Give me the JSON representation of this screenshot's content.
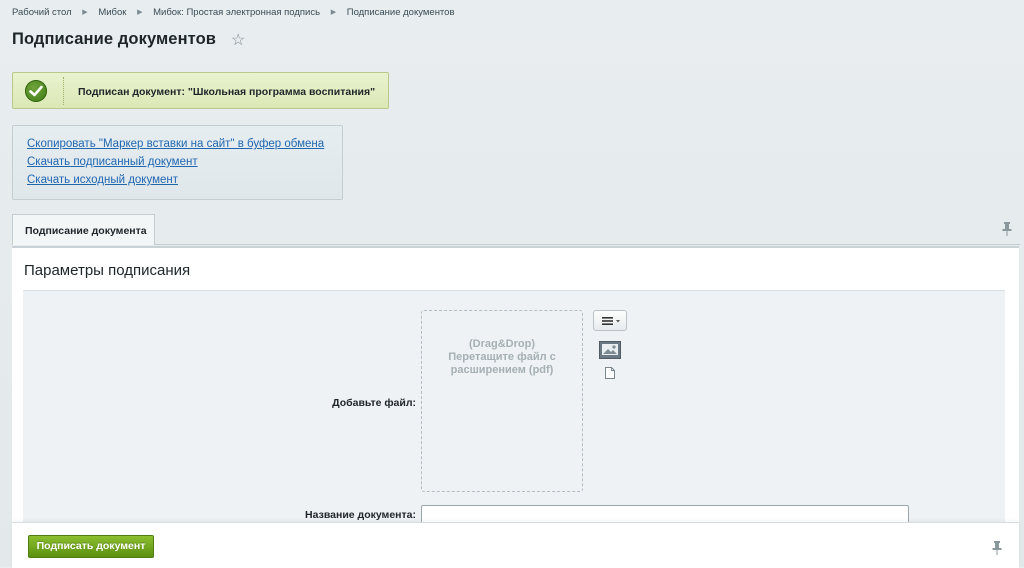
{
  "breadcrumb": {
    "items": [
      "Рабочий стол",
      "Мибок",
      "Мибок: Простая электронная подпись",
      "Подписание документов"
    ]
  },
  "page": {
    "title": "Подписание документов"
  },
  "notice": {
    "text": "Подписан документ:  \"Школьная программа воспитания\""
  },
  "links": {
    "copy_marker": "Скопировать \"Маркер вставки на сайт\" в буфер обмена",
    "download_signed": "Скачать подписанный документ",
    "download_original": "Скачать исходный документ"
  },
  "tabs": [
    {
      "label": "Подписание документа"
    }
  ],
  "form": {
    "section_title": "Параметры подписания",
    "file_label": "Добавьте файл:",
    "dropzone_line1": "(Drag&Drop)",
    "dropzone_line2": "Перетащите файл с",
    "dropzone_line3": "расширением (pdf)",
    "doc_name_label": "Название документа:",
    "doc_name_value": ""
  },
  "footer": {
    "submit_label": "Подписать документ"
  },
  "colors": {
    "accent_green": "#6aa01c",
    "link_blue": "#2067b0",
    "notice_bg": "#e2edc3"
  },
  "icons": [
    "star-icon",
    "checkmark-icon",
    "pin-icon",
    "menu-icon",
    "image-icon",
    "file-icon"
  ]
}
